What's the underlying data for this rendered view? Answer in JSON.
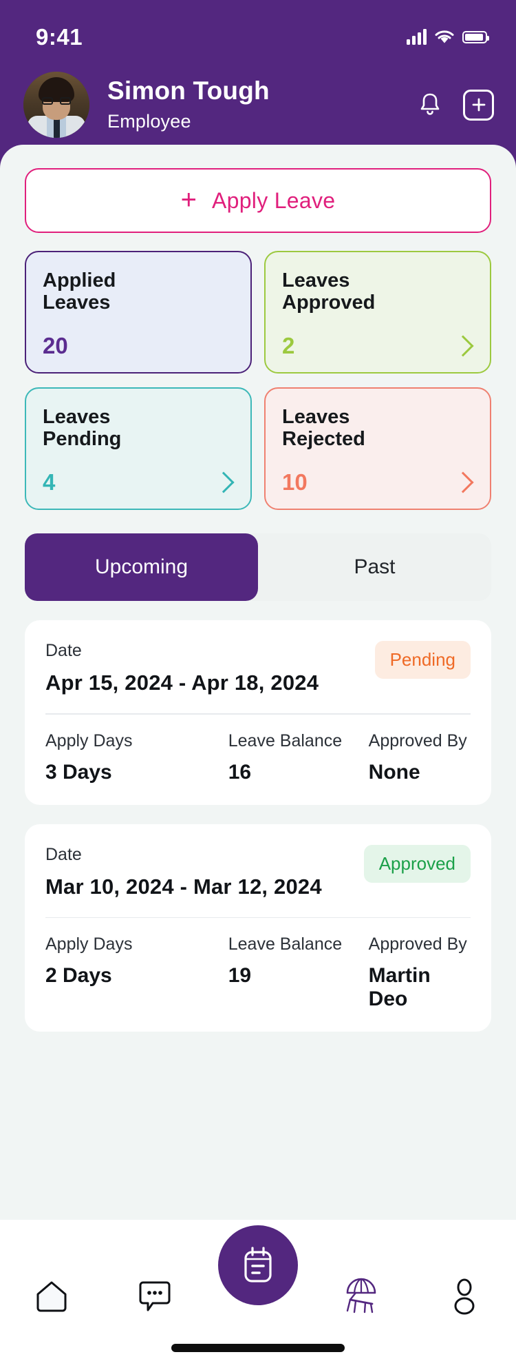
{
  "status_bar": {
    "time": "9:41",
    "signal_icon": "cellular-signal-icon",
    "wifi_icon": "wifi-icon",
    "battery_icon": "battery-icon"
  },
  "header": {
    "avatar_alt": "user-avatar",
    "user_name": "Simon Tough",
    "user_role": "Employee",
    "notification_icon": "bell-icon",
    "add_icon": "plus-square-icon",
    "background_color": "#53277F"
  },
  "apply_button": {
    "label": "Apply Leave",
    "plus_icon": "plus-icon",
    "accent_color": "#e01f7c"
  },
  "stats": [
    {
      "title": "Applied Leaves",
      "value": "20",
      "border_color": "#4b2178",
      "background_color": "#e8edf8",
      "value_color": "#5b2d90",
      "has_chevron": false,
      "name": "applied-leaves"
    },
    {
      "title": "Leaves Approved",
      "value": "2",
      "border_color": "#9cc93f",
      "background_color": "#eef5e7",
      "value_color": "#9cc93f",
      "has_chevron": true,
      "name": "leaves-approved"
    },
    {
      "title": "Leaves Pending",
      "value": "4",
      "border_color": "#3cb8b8",
      "background_color": "#e8f4f3",
      "value_color": "#34b5b5",
      "has_chevron": true,
      "name": "leaves-pending"
    },
    {
      "title": "Leaves Rejected",
      "value": "10",
      "border_color": "#ef8070",
      "background_color": "#faeeed",
      "value_color": "#f2785f",
      "has_chevron": true,
      "name": "leaves-rejected"
    }
  ],
  "tabs": {
    "items": [
      {
        "label": "Upcoming",
        "active": true
      },
      {
        "label": "Past",
        "active": false
      }
    ],
    "active_background": "#53277F"
  },
  "leave_list": {
    "date_label": "Date",
    "columns": [
      "Apply Days",
      "Leave Balance",
      "Approved By"
    ],
    "items": [
      {
        "date_label": "Date",
        "date_range": "Apr 15, 2024 - Apr 18, 2024",
        "status": "Pending",
        "status_background": "#fdece1",
        "status_color": "#ef6a26",
        "apply_days_label": "Apply Days",
        "apply_days": "3 Days",
        "leave_balance_label": "Leave Balance",
        "leave_balance": "16",
        "approved_by_label": "Approved By",
        "approved_by": "None"
      },
      {
        "date_label": "Date",
        "date_range": "Mar 10, 2024 - Mar 12, 2024",
        "status": "Approved",
        "status_background": "#e4f5e9",
        "status_color": "#1ba049",
        "apply_days_label": "Apply Days",
        "apply_days": "2 Days",
        "leave_balance_label": "Leave Balance",
        "leave_balance": "19",
        "approved_by_label": "Approved By",
        "approved_by": "Martin Deo"
      }
    ]
  },
  "bottom_nav": {
    "items": [
      {
        "icon": "home-icon",
        "active": false
      },
      {
        "icon": "chat-bubble-icon",
        "active": false
      },
      {
        "icon": "beach-umbrella-icon",
        "active": true
      },
      {
        "icon": "person-icon",
        "active": false
      }
    ],
    "fab_icon": "calendar-note-icon",
    "fab_color": "#53277F",
    "home_indicator": "home-indicator"
  }
}
